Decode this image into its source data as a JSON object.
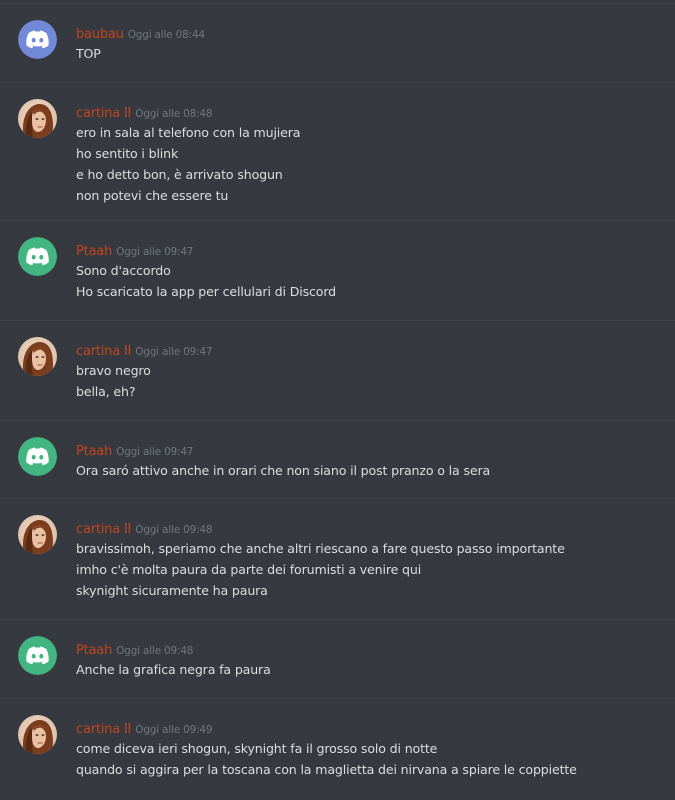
{
  "colors": {
    "background": "#36393f",
    "username": "#c1461e",
    "timestamp": "#72767d",
    "text": "#dcddde",
    "discord_blurple": "#7289da",
    "discord_green": "#43b581"
  },
  "messages": [
    {
      "username": "baubau",
      "timestamp": "Oggi alle 08:44",
      "avatar": "discord-blurple-icon",
      "lines": [
        "TOP"
      ]
    },
    {
      "username": "cartina II",
      "timestamp": "Oggi alle 08:48",
      "avatar": "woman-photo",
      "lines": [
        "ero in sala al telefono con la mujiera",
        "ho sentito i blink",
        "e ho detto bon, è arrivato shogun",
        "non potevi che essere tu"
      ]
    },
    {
      "username": "Ptaah",
      "timestamp": "Oggi alle 09:47",
      "avatar": "discord-green-icon",
      "lines": [
        "Sono d'accordo",
        "Ho scaricato la app per cellulari di Discord"
      ]
    },
    {
      "username": "cartina II",
      "timestamp": "Oggi alle 09:47",
      "avatar": "woman-photo",
      "lines": [
        "bravo negro",
        "bella, eh?"
      ]
    },
    {
      "username": "Ptaah",
      "timestamp": "Oggi alle 09:47",
      "avatar": "discord-green-icon",
      "lines": [
        "Ora saró attivo anche in orari che non siano il post pranzo o la sera"
      ]
    },
    {
      "username": "cartina II",
      "timestamp": "Oggi alle 09:48",
      "avatar": "woman-photo",
      "lines": [
        "bravissimoh, speriamo che anche altri riescano a fare questo passo importante",
        "imho c'è molta paura da parte dei forumisti a venire qui",
        "skynight sicuramente ha paura"
      ]
    },
    {
      "username": "Ptaah",
      "timestamp": "Oggi alle 09:48",
      "avatar": "discord-green-icon",
      "lines": [
        "Anche la grafica negra fa paura"
      ]
    },
    {
      "username": "cartina II",
      "timestamp": "Oggi alle 09:49",
      "avatar": "woman-photo",
      "lines": [
        "come diceva ieri shogun, skynight fa il grosso solo di notte",
        "quando si aggira per la toscana con la maglietta dei nirvana a spiare le coppiette"
      ]
    }
  ]
}
